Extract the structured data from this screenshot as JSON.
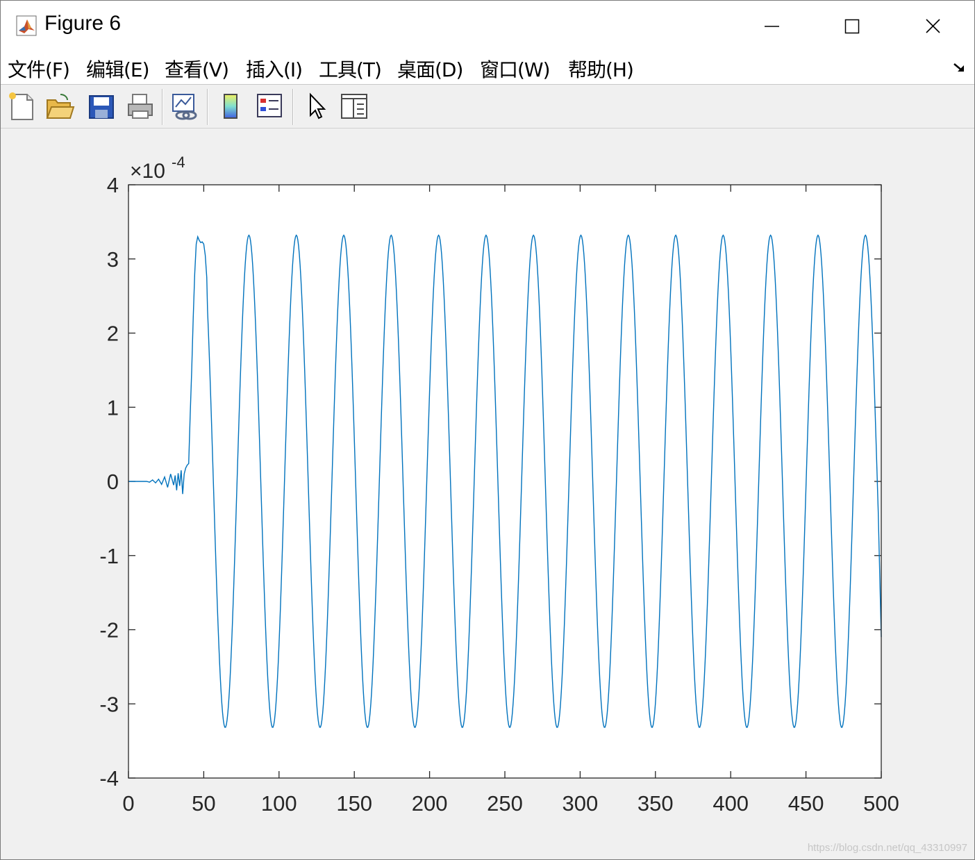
{
  "window": {
    "title": "Figure 6",
    "app_icon": "matlab-logo-icon",
    "controls": [
      "minimize-icon",
      "maximize-icon",
      "close-icon"
    ]
  },
  "menu": {
    "items": [
      "文件(F)",
      "编辑(E)",
      "查看(V)",
      "插入(I)",
      "工具(T)",
      "桌面(D)",
      "窗口(W)",
      "帮助(H)"
    ],
    "dock_icon": "dock-arrow-icon"
  },
  "toolbar": {
    "buttons": [
      "new-figure-icon",
      "open-file-icon",
      "save-icon",
      "print-icon",
      "link-plot-icon",
      "colorbar-icon",
      "legend-icon",
      "edit-plot-pointer-icon",
      "property-editor-icon"
    ]
  },
  "chart_data": {
    "type": "line",
    "title": "",
    "xlabel": "",
    "ylabel": "",
    "xlim": [
      0,
      500
    ],
    "ylim": [
      -4,
      4
    ],
    "y_multiplier": "×10",
    "y_exponent": "-4",
    "xticks": [
      "0",
      "50",
      "100",
      "150",
      "200",
      "250",
      "300",
      "350",
      "400",
      "450",
      "500"
    ],
    "yticks": [
      "4",
      "3",
      "2",
      "1",
      "0",
      "-1",
      "-2",
      "-3",
      "-4"
    ],
    "grid": false,
    "color": "#0072BD",
    "series": [
      {
        "description": "sinusoid values in units of 1e-4",
        "transient": {
          "x": [
            0,
            12,
            14,
            16,
            18,
            20,
            22,
            24,
            26,
            28,
            30,
            31,
            32,
            33,
            34,
            35,
            36,
            37,
            38,
            39,
            40,
            41,
            42,
            43,
            44,
            45,
            46,
            47,
            48,
            49,
            50,
            51,
            52
          ],
          "y": [
            0,
            0,
            -0.01,
            0.02,
            -0.02,
            0.03,
            -0.04,
            0.06,
            -0.08,
            0.1,
            -0.05,
            0.08,
            -0.12,
            0.11,
            -0.06,
            0.15,
            -0.17,
            0.1,
            0.18,
            0.22,
            0.24,
            0.9,
            1.5,
            2.2,
            2.8,
            3.2,
            3.3,
            3.25,
            3.22,
            3.23,
            3.2,
            3.05,
            2.75
          ]
        },
        "steady": {
          "amplitude": 3.32,
          "period": 31.5,
          "first_peak_x": 80,
          "x_start": 52,
          "x_end": 500,
          "end_value": -2.1
        }
      }
    ]
  },
  "watermark": "https://blog.csdn.net/qq_43310997"
}
